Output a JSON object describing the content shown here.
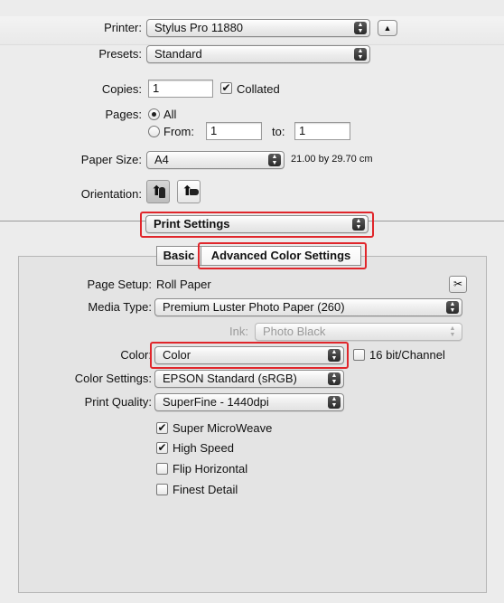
{
  "printer": {
    "label": "Printer:",
    "value": "Stylus Pro 11880"
  },
  "presets": {
    "label": "Presets:",
    "value": "Standard"
  },
  "copies": {
    "label": "Copies:",
    "value": "1",
    "collated_label": "Collated",
    "collated": true
  },
  "pages": {
    "label": "Pages:",
    "all_label": "All",
    "from_label": "From:",
    "from_value": "1",
    "to_label": "to:",
    "to_value": "1",
    "selected": "All"
  },
  "paper_size": {
    "label": "Paper Size:",
    "value": "A4",
    "dimensions": "21.00 by 29.70 cm"
  },
  "orientation": {
    "label": "Orientation:",
    "selected": "portrait"
  },
  "section_menu": {
    "value": "Print Settings"
  },
  "tabs": [
    {
      "label": "Basic",
      "selected": false
    },
    {
      "label": "Advanced Color Settings",
      "selected": true
    }
  ],
  "settings": {
    "page_setup": {
      "label": "Page Setup:",
      "value": "Roll Paper"
    },
    "media_type": {
      "label": "Media Type:",
      "value": "Premium Luster Photo Paper (260)"
    },
    "ink": {
      "label": "Ink:",
      "value": "Photo Black"
    },
    "color": {
      "label": "Color:",
      "value": "Color",
      "bit_label": "16 bit/Channel",
      "bit_checked": false
    },
    "color_settings": {
      "label": "Color Settings:",
      "value": "EPSON Standard (sRGB)"
    },
    "print_quality": {
      "label": "Print Quality:",
      "value": "SuperFine - 1440dpi"
    },
    "options": [
      {
        "label": "Super MicroWeave",
        "checked": true
      },
      {
        "label": "High Speed",
        "checked": true
      },
      {
        "label": "Flip Horizontal",
        "checked": false
      },
      {
        "label": "Finest Detail",
        "checked": false
      }
    ]
  },
  "colors": {
    "highlight": "#e0262b",
    "panel": "#e4e4e4",
    "window": "#ececec"
  }
}
